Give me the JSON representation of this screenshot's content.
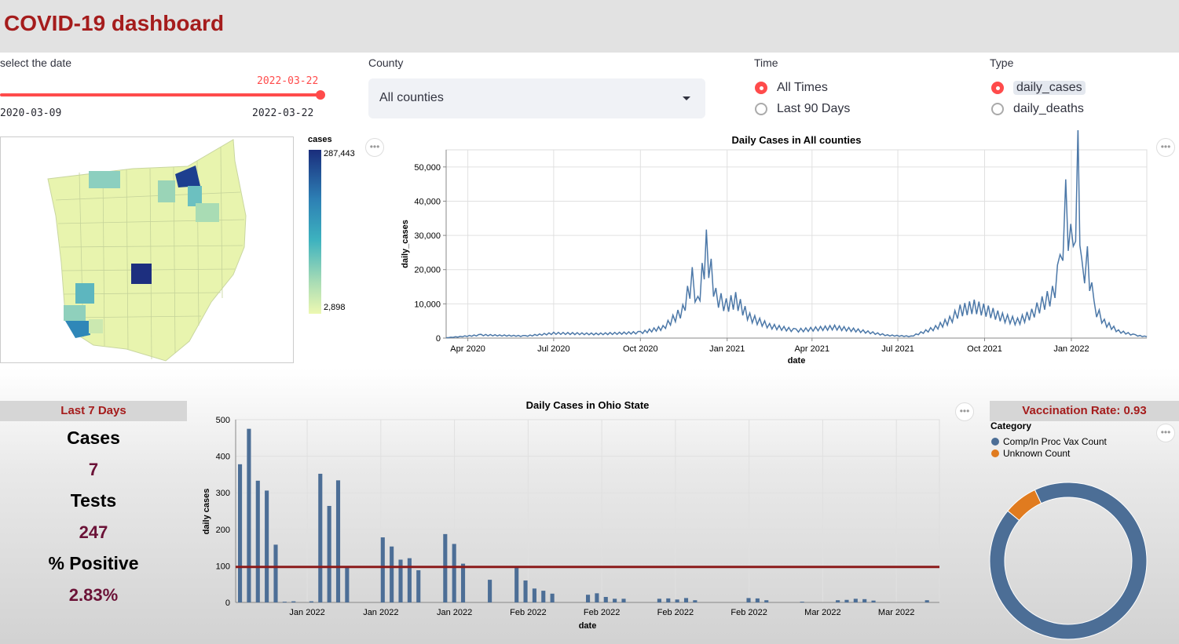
{
  "app": {
    "title": "COVID-19 dashboard"
  },
  "date_slider": {
    "label": "select the date",
    "current": "2022-03-22",
    "min": "2020-03-09",
    "max": "2022-03-22",
    "position": 1.0
  },
  "county": {
    "label": "County",
    "value": "All counties"
  },
  "time": {
    "label": "Time",
    "options": [
      "All Times",
      "Last 90 Days"
    ],
    "selected": "All Times"
  },
  "type": {
    "label": "Type",
    "options": [
      "daily_cases",
      "daily_deaths"
    ],
    "selected": "daily_cases"
  },
  "colors": {
    "accent": "#ff4b4b",
    "title_red": "#a51c1c",
    "line_blue": "#4c78a8",
    "reference_line": "#8b1a1a",
    "unknown_orange": "#e07b1f"
  },
  "map_legend": {
    "title": "cases",
    "max": "287,443",
    "min": "2,898"
  },
  "main_chart": {
    "title": "Daily Cases in All counties",
    "xlabel": "date",
    "ylabel": "daily_cases",
    "x_ticks": [
      "Apr 2020",
      "Jul 2020",
      "Oct 2020",
      "Jan 2021",
      "Apr 2021",
      "Jul 2021",
      "Oct 2021",
      "Jan 2022"
    ],
    "y_ticks": [
      "0",
      "10,000",
      "20,000",
      "30,000",
      "40,000",
      "50,000"
    ]
  },
  "stats": {
    "header": "Last 7 Days",
    "cases_label": "Cases",
    "cases_value": "7",
    "tests_label": "Tests",
    "tests_value": "247",
    "positive_label": "% Positive",
    "positive_value": "2.83%"
  },
  "bottom_chart": {
    "title": "Daily Cases in Ohio State",
    "xlabel": "date",
    "ylabel": "daily cases",
    "x_ticks": [
      "Jan 2022",
      "Jan 2022",
      "Jan 2022",
      "Feb 2022",
      "Feb 2022",
      "Feb 2022",
      "Feb 2022",
      "Mar 2022",
      "Mar 2022"
    ],
    "y_ticks": [
      "0",
      "100",
      "200",
      "300",
      "400",
      "500"
    ]
  },
  "vaccination": {
    "header": "Vaccination Rate: 0.93",
    "legend_title": "Category",
    "legend": [
      {
        "label": "Comp/In Proc Vax Count",
        "color": "#4c6e96"
      },
      {
        "label": "Unknown Count",
        "color": "#e07b1f"
      }
    ]
  },
  "chart_data": [
    {
      "type": "line",
      "title": "Daily Cases in All counties",
      "xlabel": "date",
      "ylabel": "daily_cases",
      "ylim": [
        0,
        55000
      ],
      "x": [
        "2020-03-09",
        "2020-04-15",
        "2020-06-01",
        "2020-07-01",
        "2020-08-15",
        "2020-10-01",
        "2020-10-25",
        "2020-11-15",
        "2020-11-25",
        "2020-12-01",
        "2020-12-10",
        "2020-12-20",
        "2020-12-31",
        "2021-01-10",
        "2021-01-25",
        "2021-02-15",
        "2021-03-15",
        "2021-04-10",
        "2021-04-25",
        "2021-05-20",
        "2021-06-20",
        "2021-07-15",
        "2021-08-10",
        "2021-08-25",
        "2021-09-05",
        "2021-09-20",
        "2021-10-05",
        "2021-10-20",
        "2021-11-05",
        "2021-11-20",
        "2021-12-01",
        "2021-12-12",
        "2021-12-20",
        "2021-12-26",
        "2022-01-03",
        "2022-01-08",
        "2022-01-12",
        "2022-01-18",
        "2022-01-25",
        "2022-02-05",
        "2022-02-20",
        "2022-03-10",
        "2022-03-22"
      ],
      "y": [
        100,
        900,
        600,
        1400,
        1200,
        1600,
        3000,
        8000,
        17000,
        10000,
        26000,
        12000,
        9500,
        11000,
        6000,
        3500,
        2200,
        2800,
        3100,
        2200,
        800,
        500,
        3000,
        5200,
        8000,
        9200,
        7800,
        6000,
        4800,
        7000,
        10000,
        12500,
        20000,
        38000,
        22000,
        50500,
        19000,
        22000,
        9000,
        4500,
        2000,
        800,
        400
      ]
    },
    {
      "type": "bar",
      "title": "Daily Cases in Ohio State",
      "xlabel": "date",
      "ylabel": "daily cases",
      "ylim": [
        0,
        500
      ],
      "values": [
        378,
        475,
        333,
        306,
        158,
        2,
        3,
        0,
        3,
        352,
        264,
        334,
        95,
        0,
        0,
        0,
        178,
        153,
        117,
        121,
        88,
        0,
        0,
        187,
        160,
        106,
        0,
        0,
        62,
        0,
        0,
        97,
        60,
        38,
        32,
        24,
        0,
        0,
        0,
        21,
        25,
        15,
        10,
        10,
        0,
        0,
        0,
        10,
        11,
        8,
        12,
        6,
        0,
        0,
        0,
        0,
        0,
        12,
        11,
        6,
        0,
        0,
        0,
        2,
        0,
        0,
        0,
        6,
        7,
        10,
        9,
        5,
        0,
        0,
        0,
        0,
        0,
        6
      ],
      "reference_line": 97
    },
    {
      "type": "pie",
      "title": "Vaccination Rate: 0.93",
      "categories": [
        "Comp/In Proc Vax Count",
        "Unknown Count"
      ],
      "values": [
        0.93,
        0.07
      ]
    }
  ]
}
